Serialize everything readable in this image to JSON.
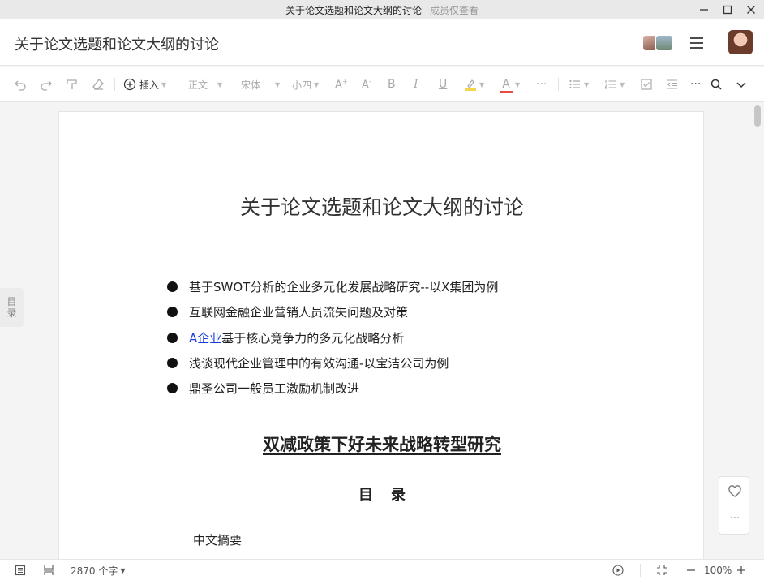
{
  "window": {
    "title": "关于论文选题和论文大纲的讨论",
    "note": "成员仅查看"
  },
  "header": {
    "doc_name": "关于论文选题和论文大纲的讨论"
  },
  "toolbar": {
    "insert_label": "插入",
    "style_label": "正文",
    "font_label": "宋体",
    "size_label": "小四",
    "highlight_color": "#f5d64a",
    "font_color": "#e54d42"
  },
  "document": {
    "title": "关于论文选题和论文大纲的讨论",
    "bullets": [
      {
        "link": "",
        "text": "基于SWOT分析的企业多元化发展战略研究--以X集团为例"
      },
      {
        "link": "",
        "text": "互联网金融企业营销人员流失问题及对策"
      },
      {
        "link": "A企业",
        "text": "基于核心竞争力的多元化战略分析"
      },
      {
        "link": "",
        "text": "浅谈现代企业管理中的有效沟通-以宝洁公司为例"
      },
      {
        "link": "",
        "text": "鼎圣公司一般员工激励机制改进"
      }
    ],
    "section_title": "双减政策下好未来战略转型研究",
    "toc_title": "目录",
    "toc_first": "中文摘要"
  },
  "outline_tab": {
    "line1": "目",
    "line2": "录"
  },
  "statusbar": {
    "word_count": "2870 个字",
    "zoom": "100%"
  }
}
